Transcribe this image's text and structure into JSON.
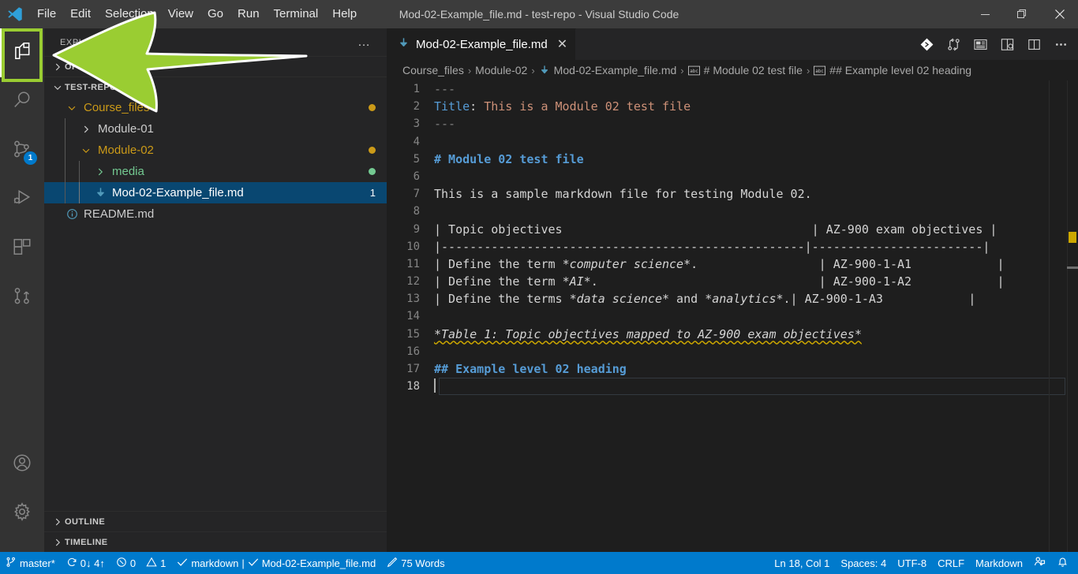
{
  "window": {
    "title": "Mod-02-Example_file.md - test-repo - Visual Studio Code",
    "minimize_label": "─",
    "maximize_label": "❐",
    "close_label": "✕"
  },
  "menu": {
    "items": [
      {
        "label": "File"
      },
      {
        "label": "Edit"
      },
      {
        "label": "Selection"
      },
      {
        "label": "View"
      },
      {
        "label": "Go"
      },
      {
        "label": "Run"
      },
      {
        "label": "Terminal"
      },
      {
        "label": "Help"
      }
    ]
  },
  "activity_bar": {
    "items": [
      {
        "icon": "explorer-files-icon",
        "name": "explorer",
        "active": true,
        "badge": ""
      },
      {
        "icon": "search-icon",
        "name": "search",
        "active": false,
        "badge": ""
      },
      {
        "icon": "source-control-icon",
        "name": "source-control",
        "active": false,
        "badge": "1"
      },
      {
        "icon": "run-debug-icon",
        "name": "run-and-debug",
        "active": false,
        "badge": ""
      },
      {
        "icon": "extensions-icon",
        "name": "extensions",
        "active": false,
        "badge": ""
      },
      {
        "icon": "pull-request-icon",
        "name": "pull-requests",
        "active": false,
        "badge": ""
      }
    ],
    "bottom_items": [
      {
        "icon": "account-icon",
        "name": "accounts"
      },
      {
        "icon": "gear-icon",
        "name": "manage-settings"
      }
    ],
    "highlight_color": "#9acd32"
  },
  "sidebar": {
    "title": "EXPLORER",
    "more_actions_label": "…",
    "open_editors_label": "OPEN EDITORS",
    "workspace_label": "TEST-REPO",
    "tree": [
      {
        "label": "Course_files",
        "depth": 1,
        "type": "folder",
        "expanded": true,
        "color": "amber",
        "dot": "#cb9a18",
        "selected": false,
        "count": ""
      },
      {
        "label": "Module-01",
        "depth": 2,
        "type": "folder",
        "expanded": false,
        "color": "default",
        "dot": "",
        "selected": false,
        "count": ""
      },
      {
        "label": "Module-02",
        "depth": 2,
        "type": "folder",
        "expanded": true,
        "color": "amber",
        "dot": "#cb9a18",
        "selected": false,
        "count": ""
      },
      {
        "label": "media",
        "depth": 3,
        "type": "folder",
        "expanded": false,
        "color": "green",
        "dot": "#73c991",
        "selected": false,
        "count": ""
      },
      {
        "label": "Mod-02-Example_file.md",
        "depth": 3,
        "type": "markdown-file",
        "expanded": false,
        "color": "default",
        "dot": "",
        "selected": true,
        "count": "1"
      },
      {
        "label": "README.md",
        "depth": 1,
        "type": "info-file",
        "expanded": false,
        "color": "default",
        "dot": "",
        "selected": false,
        "count": ""
      }
    ],
    "outline_label": "OUTLINE",
    "timeline_label": "TIMELINE"
  },
  "editor": {
    "tab": {
      "label": "Mod-02-Example_file.md",
      "close_label": "✕",
      "icon": "markdown-file-icon"
    },
    "toolbar_icons": [
      {
        "name": "git-lens-icon"
      },
      {
        "name": "git-compare-icon"
      },
      {
        "name": "open-preview-icon"
      },
      {
        "name": "open-preview-to-side-icon"
      },
      {
        "name": "split-editor-icon"
      },
      {
        "name": "more-actions-icon"
      }
    ],
    "breadcrumbs": [
      {
        "label": "Course_files",
        "icon": ""
      },
      {
        "label": "Module-02",
        "icon": ""
      },
      {
        "label": "Mod-02-Example_file.md",
        "icon": "markdown-file-icon"
      },
      {
        "label": "# Module 02 test file",
        "icon": "symbol-string-icon"
      },
      {
        "label": "## Example level 02 heading",
        "icon": "symbol-string-icon"
      }
    ],
    "lines": [
      {
        "num": "1",
        "segments": [
          {
            "text": "---",
            "cls": "tok-punct"
          }
        ]
      },
      {
        "num": "2",
        "segments": [
          {
            "text": "Title",
            "cls": "tok-key"
          },
          {
            "text": ": ",
            "cls": "tok-plain"
          },
          {
            "text": "This is a Module 02 test file",
            "cls": "tok-str"
          }
        ]
      },
      {
        "num": "3",
        "segments": [
          {
            "text": "---",
            "cls": "tok-punct"
          }
        ]
      },
      {
        "num": "4",
        "segments": []
      },
      {
        "num": "5",
        "segments": [
          {
            "text": "# Module 02 test file",
            "cls": "tok-head"
          }
        ]
      },
      {
        "num": "6",
        "segments": []
      },
      {
        "num": "7",
        "segments": [
          {
            "text": "This is a sample markdown file for testing Module 02.",
            "cls": "tok-plain"
          }
        ]
      },
      {
        "num": "8",
        "segments": []
      },
      {
        "num": "9",
        "segments": [
          {
            "text": "| Topic objectives                                   | AZ-900 exam objectives |",
            "cls": "tok-plain"
          }
        ]
      },
      {
        "num": "10",
        "segments": [
          {
            "text": "|---------------------------------------------------|------------------------|",
            "cls": "tok-plain"
          }
        ]
      },
      {
        "num": "11",
        "segments": [
          {
            "text": "| Define the term ",
            "cls": "tok-plain"
          },
          {
            "text": "*computer science*",
            "cls": "tok-ital"
          },
          {
            "text": ".                 | AZ-900-1-A1            |",
            "cls": "tok-plain"
          }
        ]
      },
      {
        "num": "12",
        "segments": [
          {
            "text": "| Define the term ",
            "cls": "tok-plain"
          },
          {
            "text": "*AI*",
            "cls": "tok-ital"
          },
          {
            "text": ".                               | AZ-900-1-A2            |",
            "cls": "tok-plain"
          }
        ]
      },
      {
        "num": "13",
        "segments": [
          {
            "text": "| Define the terms ",
            "cls": "tok-plain"
          },
          {
            "text": "*data science*",
            "cls": "tok-ital"
          },
          {
            "text": " and ",
            "cls": "tok-plain"
          },
          {
            "text": "*analytics*",
            "cls": "tok-ital"
          },
          {
            "text": ".| AZ-900-1-A3            |",
            "cls": "tok-plain"
          }
        ]
      },
      {
        "num": "14",
        "segments": []
      },
      {
        "num": "15",
        "segments": [
          {
            "text": "*Table 1: Topic objectives mapped to AZ-900 exam objectives*",
            "cls": "tok-ital squiggly"
          }
        ]
      },
      {
        "num": "16",
        "segments": []
      },
      {
        "num": "17",
        "segments": [
          {
            "text": "## Example level 02 heading",
            "cls": "tok-head"
          }
        ]
      },
      {
        "num": "18",
        "segments": [],
        "current": true
      }
    ],
    "overview_ruler": {
      "warning_color": "#cca700",
      "selection_color": "#6e6e6e"
    }
  },
  "status_bar": {
    "branch": "master*",
    "sync": "0↓ 4↑",
    "errors": "0",
    "warnings": "1",
    "spell_lang": "markdown",
    "spell_file": "Mod-02-Example_file.md",
    "word_count": "75 Words",
    "cursor_position": "Ln 18, Col 1",
    "indentation": "Spaces: 4",
    "encoding": "UTF-8",
    "eol": "CRLF",
    "language_mode": "Markdown",
    "background": "#007acc",
    "separator": "|"
  }
}
